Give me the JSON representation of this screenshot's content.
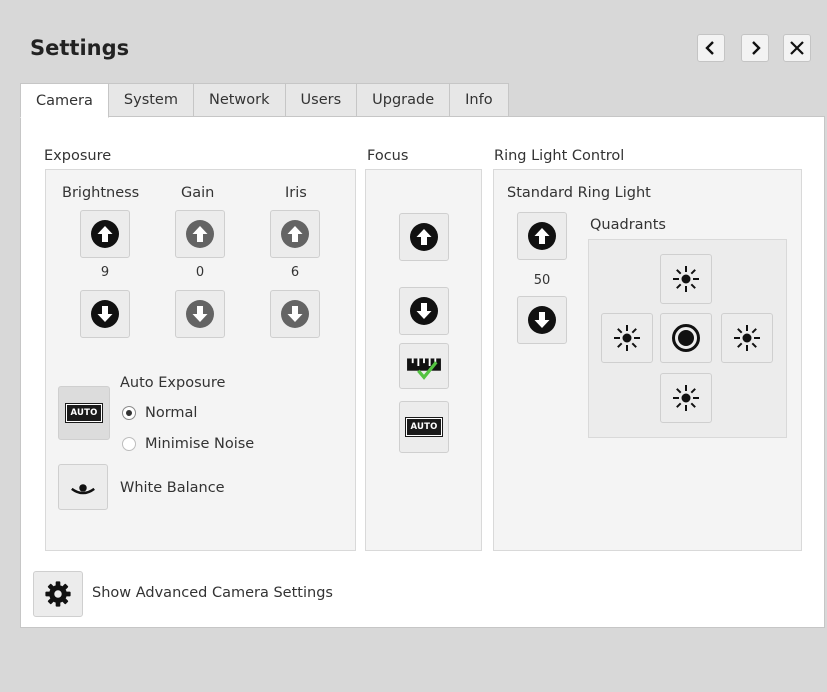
{
  "title": "Settings",
  "nav": {
    "prev_icon": "chevron-left-icon",
    "next_icon": "chevron-right-icon",
    "close_icon": "close-icon"
  },
  "tabs": [
    "Camera",
    "System",
    "Network",
    "Users",
    "Upgrade",
    "Info"
  ],
  "active_tab": "Camera",
  "exposure": {
    "title": "Exposure",
    "brightness": {
      "label": "Brightness",
      "value": "9"
    },
    "gain": {
      "label": "Gain",
      "value": "0"
    },
    "iris": {
      "label": "Iris",
      "value": "6"
    },
    "auto_exposure": {
      "label": "Auto Exposure",
      "button_text": "AUTO",
      "options": [
        "Normal",
        "Minimise Noise"
      ],
      "selected": "Normal"
    },
    "white_balance": {
      "label": "White Balance"
    }
  },
  "focus": {
    "title": "Focus",
    "auto_text": "AUTO"
  },
  "ring_light": {
    "title": "Ring Light Control",
    "standard": {
      "label": "Standard Ring Light",
      "value": "50"
    },
    "quadrants": {
      "label": "Quadrants"
    }
  },
  "advanced": {
    "label": "Show Advanced Camera Settings"
  },
  "colors": {
    "icon_dark": "#111111",
    "icon_dim": "#646464",
    "check_green": "#54c341"
  }
}
